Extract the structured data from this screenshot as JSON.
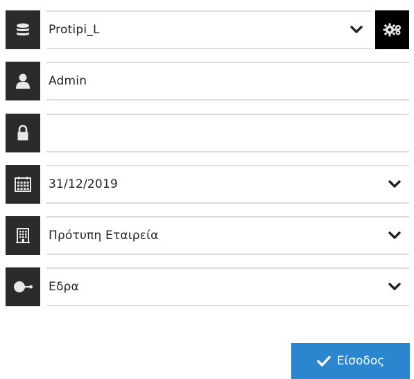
{
  "form": {
    "database": {
      "value": "Protipi_L",
      "icon": "database-icon"
    },
    "user": {
      "value": "Admin",
      "icon": "user-icon"
    },
    "password": {
      "value": "",
      "placeholder": "",
      "icon": "lock-icon"
    },
    "date": {
      "value": "31/12/2019",
      "icon": "calendar-icon"
    },
    "company": {
      "value": "Πρότυπη Εταιρεία",
      "icon": "building-icon"
    },
    "branch": {
      "value": "Εδρα",
      "icon": "branch-icon"
    },
    "settings": {
      "icon": "gear-icon"
    }
  },
  "login_button": {
    "label": "Είσοδος",
    "icon": "check-icon"
  },
  "colors": {
    "icon_bg": "#2b2b2b",
    "settings_bg": "#000000",
    "field_border": "#dcdcdc",
    "button_bg": "#2b86cf",
    "button_text": "#ffffff"
  }
}
